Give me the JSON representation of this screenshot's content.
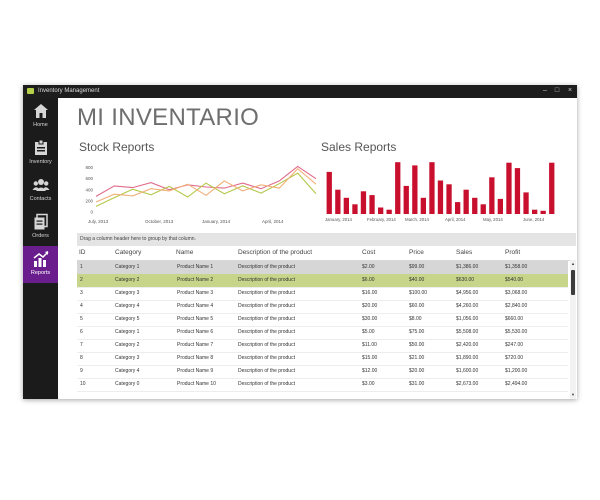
{
  "window": {
    "title": "Inventory Management"
  },
  "sidebar": {
    "items": [
      {
        "label": "Home",
        "icon": "home-icon"
      },
      {
        "label": "Inventory",
        "icon": "inventory-icon"
      },
      {
        "label": "Contacts",
        "icon": "contacts-icon"
      },
      {
        "label": "Orders",
        "icon": "orders-icon"
      },
      {
        "label": "Reports",
        "icon": "reports-icon",
        "active": true
      }
    ]
  },
  "page": {
    "title": "MI INVENTARIO"
  },
  "stock_report": {
    "title": "Stock Reports",
    "chart_data": {
      "type": "line",
      "title": "",
      "x_ticks": [
        "July, 2013",
        "October, 2013",
        "January, 2014",
        "April, 2014"
      ],
      "y_ticks": [
        800,
        600,
        400,
        200,
        0
      ],
      "ylim": [
        0,
        900
      ],
      "grid": false,
      "series": [
        {
          "color": "#e06b8b",
          "values": [
            280,
            470,
            440,
            530,
            400,
            490,
            450,
            430,
            520,
            420,
            560,
            820,
            600
          ]
        },
        {
          "color": "#b5c84a",
          "values": [
            100,
            260,
            410,
            310,
            460,
            270,
            520,
            330,
            470,
            340,
            510,
            700,
            330
          ]
        },
        {
          "color": "#f1b07a",
          "values": [
            180,
            320,
            290,
            420,
            380,
            500,
            300,
            560,
            380,
            490,
            430,
            780,
            500
          ]
        }
      ]
    }
  },
  "sales_report": {
    "title": "Sales Reports",
    "chart_data": {
      "type": "bar",
      "title": "",
      "x_ticks": [
        "January, 2014",
        "February, 2014",
        "March, 2014",
        "April, 2014",
        "May, 2014",
        "June, 2014"
      ],
      "ylim": [
        0,
        100
      ],
      "grid": false,
      "color": "#c8102e",
      "values": [
        78,
        45,
        30,
        18,
        42,
        35,
        12,
        8,
        96,
        52,
        90,
        30,
        96,
        62,
        55,
        22,
        45,
        30,
        18,
        68,
        28,
        95,
        85,
        40,
        8,
        6,
        95
      ]
    }
  },
  "grid": {
    "group_hint": "Drag a column header here to group by that column.",
    "columns": [
      "ID",
      "Category",
      "Name",
      "Description of the product",
      "Cost",
      "Price",
      "Sales",
      "Profit"
    ],
    "rows": [
      [
        "1",
        "Category 1",
        "Product Name 1",
        "Description of the product",
        "$2.00",
        "$99.00",
        "$1,386.00",
        "$1,358.00"
      ],
      [
        "2",
        "Category 2",
        "Product Name 2",
        "Description of the product",
        "$6.00",
        "$40.00",
        "$630.00",
        "$540.00"
      ],
      [
        "3",
        "Category 3",
        "Product Name 3",
        "Description of the product",
        "$16.00",
        "$100.00",
        "$4,956.00",
        "$3,068.00"
      ],
      [
        "4",
        "Category 4",
        "Product Name 4",
        "Description of the product",
        "$20.00",
        "$60.00",
        "$4,260.00",
        "$2,840.00"
      ],
      [
        "5",
        "Category 5",
        "Product Name 5",
        "Description of the product",
        "$30.00",
        "$8.00",
        "$1,056.00",
        "$660.00"
      ],
      [
        "6",
        "Category 1",
        "Product Name 6",
        "Description of the product",
        "$5.00",
        "$75.00",
        "$5,508.00",
        "$5,530.00"
      ],
      [
        "7",
        "Category 2",
        "Product Name 7",
        "Description of the product",
        "$11.00",
        "$50.00",
        "$2,420.00",
        "$247.00"
      ],
      [
        "8",
        "Category 3",
        "Product Name 8",
        "Description of the product",
        "$15.00",
        "$21.00",
        "$1,890.00",
        "$720.00"
      ],
      [
        "9",
        "Category 4",
        "Product Name 9",
        "Description of the product",
        "$12.00",
        "$20.00",
        "$1,600.00",
        "$1,200.00"
      ],
      [
        "10",
        "Category 0",
        "Product Name 10",
        "Description of the product",
        "$3.00",
        "$31.00",
        "$2,673.00",
        "$2,494.00"
      ]
    ]
  }
}
